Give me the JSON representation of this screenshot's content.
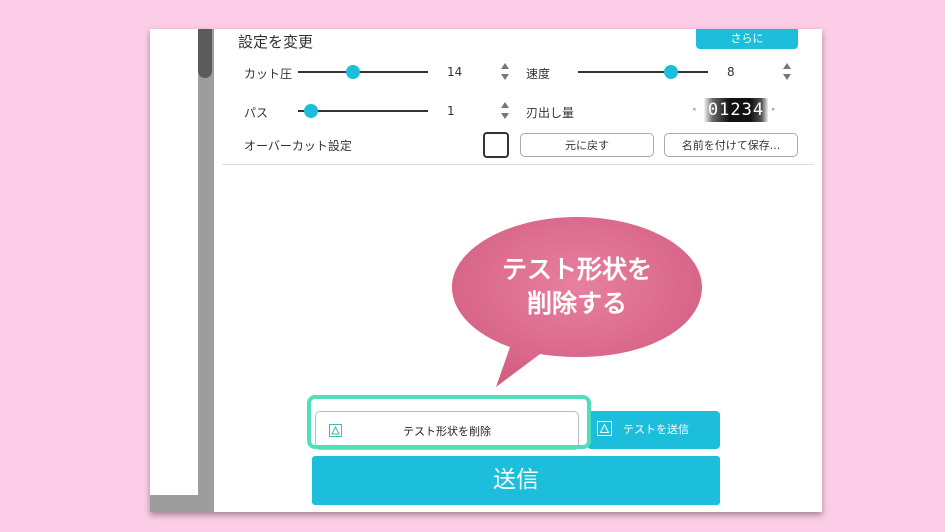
{
  "settings": {
    "title": "設定を変更",
    "more_button": "さらに",
    "cut_pressure": {
      "label": "カット圧",
      "value": "14",
      "level": 0.41
    },
    "speed": {
      "label": "速度",
      "value": "8",
      "level": 0.74
    },
    "passes": {
      "label": "パス",
      "value": "1",
      "level": 0.05
    },
    "blade_depth": {
      "label": "刃出し量",
      "digits": "01234",
      "prev_arrow": "◂",
      "next_arrow": "▸"
    },
    "overcut": {
      "label": "オーバーカット設定",
      "checked": false
    },
    "reset_button": "元に戻す",
    "save_as_button": "名前を付けて保存..."
  },
  "callout": {
    "line1": "テスト形状を",
    "line2": "削除する",
    "color": "#e0678d"
  },
  "actions": {
    "delete_test_shape": "テスト形状を削除",
    "send_test": "テストを送信",
    "send": "送信"
  },
  "colors": {
    "accent": "#1cbedb",
    "highlight": "#4fe0ba",
    "background": "#fbcde6"
  }
}
